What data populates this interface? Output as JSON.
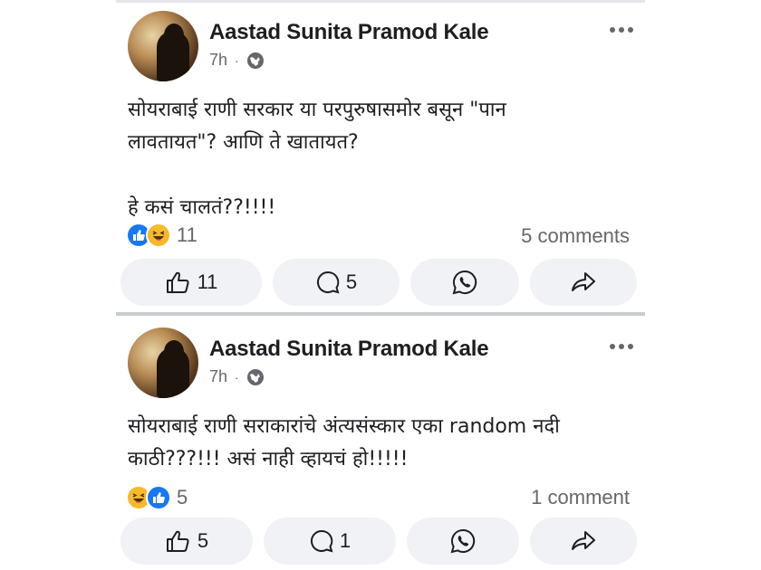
{
  "posts": [
    {
      "author": "Aastad Sunita Pramod Kale",
      "time": "7h",
      "separator": "·",
      "audience_icon": "globe-icon",
      "text": "सोयराबाई राणी सरकार या परपुरुषासमोर बसून \"पान\nलावतायत\"? आणि ते खातायत?\n\nहे कसं चालतं??!!!!",
      "reactions": {
        "icons": [
          "like-icon",
          "haha-icon"
        ],
        "count": "11"
      },
      "comments": "5 comments",
      "actions": {
        "like": "11",
        "comment": "5"
      }
    },
    {
      "author": "Aastad Sunita Pramod Kale",
      "time": "7h",
      "separator": "·",
      "audience_icon": "globe-icon",
      "text": "सोयराबाई राणी सराकारांचे अंत्यसंस्कार एका random नदी\nकाठी???!!! असं नाही व्हायचं हो!!!!!",
      "reactions": {
        "icons": [
          "haha-icon",
          "like-icon"
        ],
        "count": "5"
      },
      "comments": "1 comment",
      "actions": {
        "like": "5",
        "comment": "1"
      }
    }
  ],
  "colors": {
    "like_blue": "#1877f2",
    "haha_yellow": "#f7b928",
    "secondary_text": "#65676b",
    "button_bg": "#f0f2f5"
  }
}
